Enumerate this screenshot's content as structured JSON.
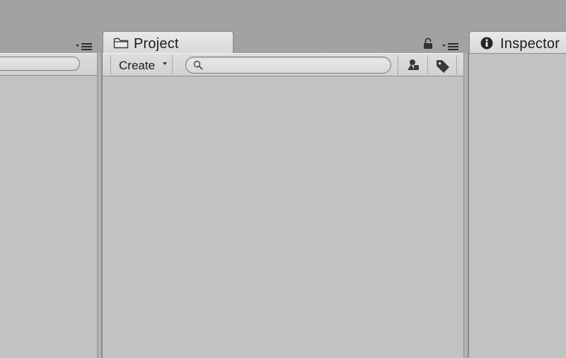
{
  "colors": {
    "window_background": "#a2a2a2",
    "panel_background": "#c2c2c2",
    "toolbar_background": "#d6d6d6",
    "tab_background": "#e2e2e2"
  },
  "left_panel": {
    "options_icon": "panel-options-icon",
    "search": {
      "value": "",
      "placeholder": ""
    }
  },
  "project_panel": {
    "tab": {
      "icon": "folder-icon",
      "label": "Project"
    },
    "lock_icon": "lock-icon",
    "options_icon": "panel-options-icon",
    "toolbar": {
      "create_label": "Create",
      "create_icon": "dropdown-caret-icon",
      "search": {
        "icon": "search-icon",
        "value": "",
        "placeholder": ""
      },
      "filter_by_type_icon": "shapes-icon",
      "filter_by_label_icon": "tag-icon"
    }
  },
  "inspector_panel": {
    "tab": {
      "icon": "info-icon",
      "label": "Inspector"
    }
  }
}
